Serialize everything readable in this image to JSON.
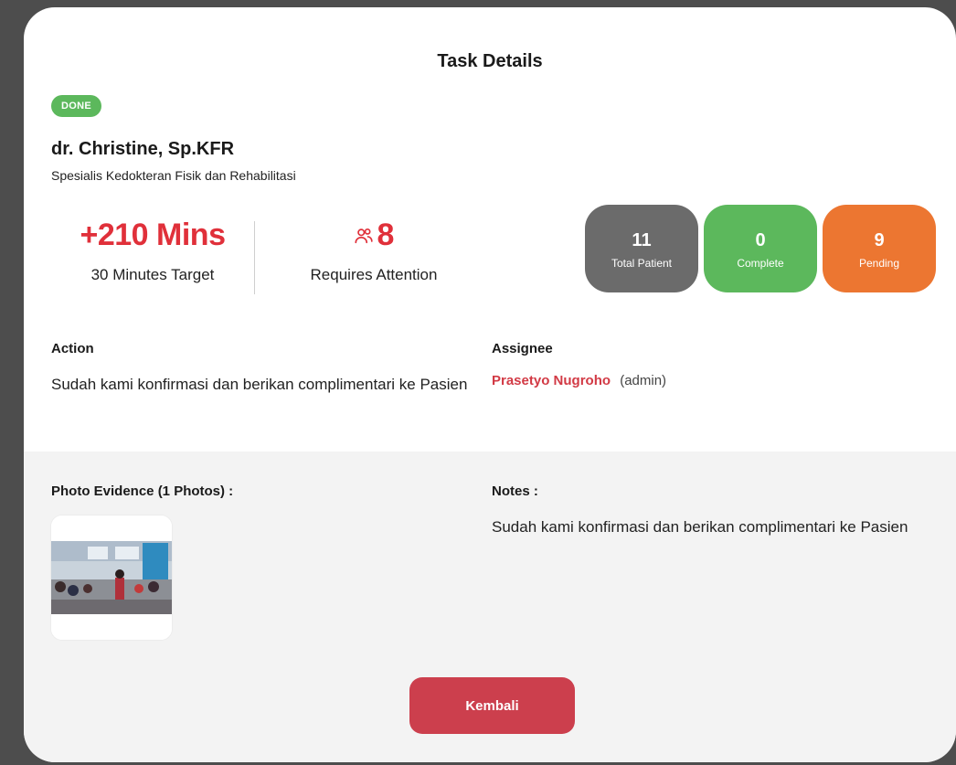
{
  "modal": {
    "title": "Task Details",
    "status": "DONE",
    "doctor": {
      "name": "dr. Christine, Sp.KFR",
      "specialty": "Spesialis Kedokteran Fisik dan Rehabilitasi"
    },
    "metrics": {
      "time_value": "+210 Mins",
      "time_caption": "30 Minutes Target",
      "attention_value": "8",
      "attention_caption": "Requires Attention"
    },
    "stats": [
      {
        "value": "11",
        "label": "Total Patient",
        "color": "#6b6b6b"
      },
      {
        "value": "0",
        "label": "Complete",
        "color": "#5cb85c"
      },
      {
        "value": "9",
        "label": "Pending",
        "color": "#ec7631"
      }
    ],
    "action": {
      "label": "Action",
      "text": "Sudah kami konfirmasi dan berikan complimentari ke Pasien"
    },
    "assignee": {
      "label": "Assignee",
      "name": "Prasetyo Nugroho",
      "role": "(admin)"
    },
    "photo_evidence": {
      "label": "Photo Evidence (1 Photos) :"
    },
    "notes": {
      "label": "Notes :",
      "text": "Sudah kami konfirmasi dan berikan complimentari ke Pasien"
    },
    "back_button": "Kembali"
  },
  "colors": {
    "accent_red": "#e0303a",
    "button_red": "#cc3f4d",
    "done_green": "#5cb85c",
    "pending_orange": "#ec7631"
  }
}
